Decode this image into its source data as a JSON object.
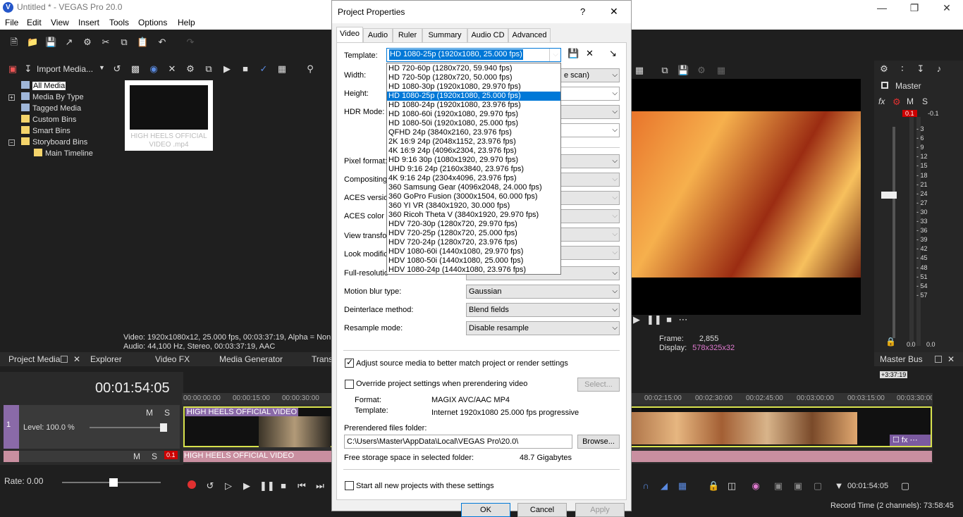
{
  "app": {
    "title": "Untitled * - VEGAS Pro 20.0",
    "icon_letter": "V"
  },
  "menu": [
    "File",
    "Edit",
    "View",
    "Insert",
    "Tools",
    "Options",
    "Help"
  ],
  "media": {
    "import_label": "Import Media...",
    "tree": [
      "All Media",
      "Media By Type",
      "Tagged Media",
      "Custom Bins",
      "Smart Bins",
      "Storyboard Bins",
      "Main Timeline"
    ],
    "thumb_caption": "HIGH HEELS OFFICIAL VIDEO .mp4",
    "info_video": "Video: 1920x1080x12, 25.000 fps, 00:03:37:19, Alpha = Non",
    "info_audio": "Audio: 44,100 Hz, Stereo, 00:03:37:19, AAC"
  },
  "bottom_tabs": [
    "Project Media",
    "Explorer",
    "Video FX",
    "Media Generator",
    "Trans"
  ],
  "timeline": {
    "timecode": "00:01:54:05",
    "level": "Level: 100.0 %",
    "m": "M",
    "s": "S",
    "rate": "Rate: 0.00",
    "clip_name": "HIGH HEELS OFFICIAL VIDEO",
    "audio_clip_name": "HIGH HEELS OFFICIAL VIDEO",
    "track_num": "1",
    "meter_val": "0.1",
    "ruler": [
      "00:00:00:00",
      "00:00:15:00",
      "00:00:30:00",
      "00:02:15:00",
      "00:02:30:00",
      "00:02:45:00",
      "00:03:00:00",
      "00:03:15:00",
      "00:03:30:00"
    ],
    "end_marker": "+3:37:19",
    "cursor_time": "00:01:54:05",
    "record_time": "Record Time (2 channels): 73:58:45"
  },
  "preview": {
    "frame_label": "Frame:",
    "frame_val": "2,855",
    "display_label": "Display:",
    "display_val": "578x325x32"
  },
  "master": {
    "title": "Master",
    "m": "M",
    "s": "S",
    "peak_l": "0.1",
    "peak_r": "-0.1",
    "ticks": [
      "3",
      "6",
      "9",
      "12",
      "15",
      "18",
      "21",
      "24",
      "27",
      "30",
      "33",
      "36",
      "39",
      "42",
      "45",
      "48",
      "51",
      "54",
      "57"
    ],
    "bottom_l": "0.0",
    "bottom_r": "0.0",
    "bus_label": "Master Bus"
  },
  "dialog": {
    "title": "Project Properties",
    "help": "?",
    "close": "✕",
    "tabs": [
      "Video",
      "Audio",
      "Ruler",
      "Summary",
      "Audio CD",
      "Advanced"
    ],
    "labels": {
      "template": "Template:",
      "width": "Width:",
      "height": "Height:",
      "hdr": "HDR Mode:",
      "pixel": "Pixel format:",
      "compositing": "Compositing",
      "aces_version": "ACES version",
      "aces_color": "ACES color s",
      "view_transform": "View transfo",
      "look": "Look modifica",
      "fullres": "Full-resolutio",
      "motion_blur": "Motion blur type:",
      "deinterlace": "Deinterlace method:",
      "resample": "Resample mode:"
    },
    "template_value": "HD 1080-25p (1920x1080, 25.000 fps)",
    "width_suffix": "e scan)",
    "templates": [
      "HD 720-60p (1280x720, 59.940 fps)",
      "HD 720-50p (1280x720, 50.000 fps)",
      "HD 1080-30p (1920x1080, 29.970 fps)",
      "HD 1080-25p (1920x1080, 25.000 fps)",
      "HD 1080-24p (1920x1080, 23.976 fps)",
      "HD 1080-60i (1920x1080, 29.970 fps)",
      "HD 1080-50i (1920x1080, 25.000 fps)",
      "QFHD 24p (3840x2160, 23.976 fps)",
      "2K 16:9 24p (2048x1152, 23.976 fps)",
      "4K 16:9 24p (4096x2304, 23.976 fps)",
      "HD 9:16 30p (1080x1920, 29.970 fps)",
      "UHD 9:16 24p (2160x3840, 23.976 fps)",
      "4K 9:16 24p (2304x4096, 23.976 fps)",
      "360 Samsung Gear (4096x2048, 24.000 fps)",
      "360 GoPro Fusion (3000x1504, 60.000 fps)",
      "360 YI VR (3840x1920, 30.000 fps)",
      "360 Ricoh Theta V (3840x1920, 29.970 fps)",
      "HDV 720-30p (1280x720, 29.970 fps)",
      "HDV 720-25p (1280x720, 25.000 fps)",
      "HDV 720-24p (1280x720, 23.976 fps)",
      "HDV 1080-60i (1440x1080, 29.970 fps)",
      "HDV 1080-50i (1440x1080, 25.000 fps)",
      "HDV 1080-24p (1440x1080, 23.976 fps)"
    ],
    "motion_blur_value": "Gaussian",
    "deinterlace_value": "Blend fields",
    "resample_value": "Disable resample",
    "adjust_label": "Adjust source media to better match project or render settings",
    "override_label": "Override project settings when prerendering video",
    "select_btn": "Select...",
    "format_label": "Format:",
    "format_val": "MAGIX AVC/AAC MP4",
    "template2_label": "Template:",
    "template2_val": "Internet 1920x1080 25.000 fps progressive",
    "prerender_label": "Prerendered files folder:",
    "prerender_path": "C:\\Users\\Master\\AppData\\Local\\VEGAS Pro\\20.0\\",
    "browse_btn": "Browse...",
    "storage_label": "Free storage space in selected folder:",
    "storage_val": "48.7 Gigabytes",
    "start_all_label": "Start all new projects with these settings",
    "ok": "OK",
    "cancel": "Cancel",
    "apply": "Apply"
  }
}
